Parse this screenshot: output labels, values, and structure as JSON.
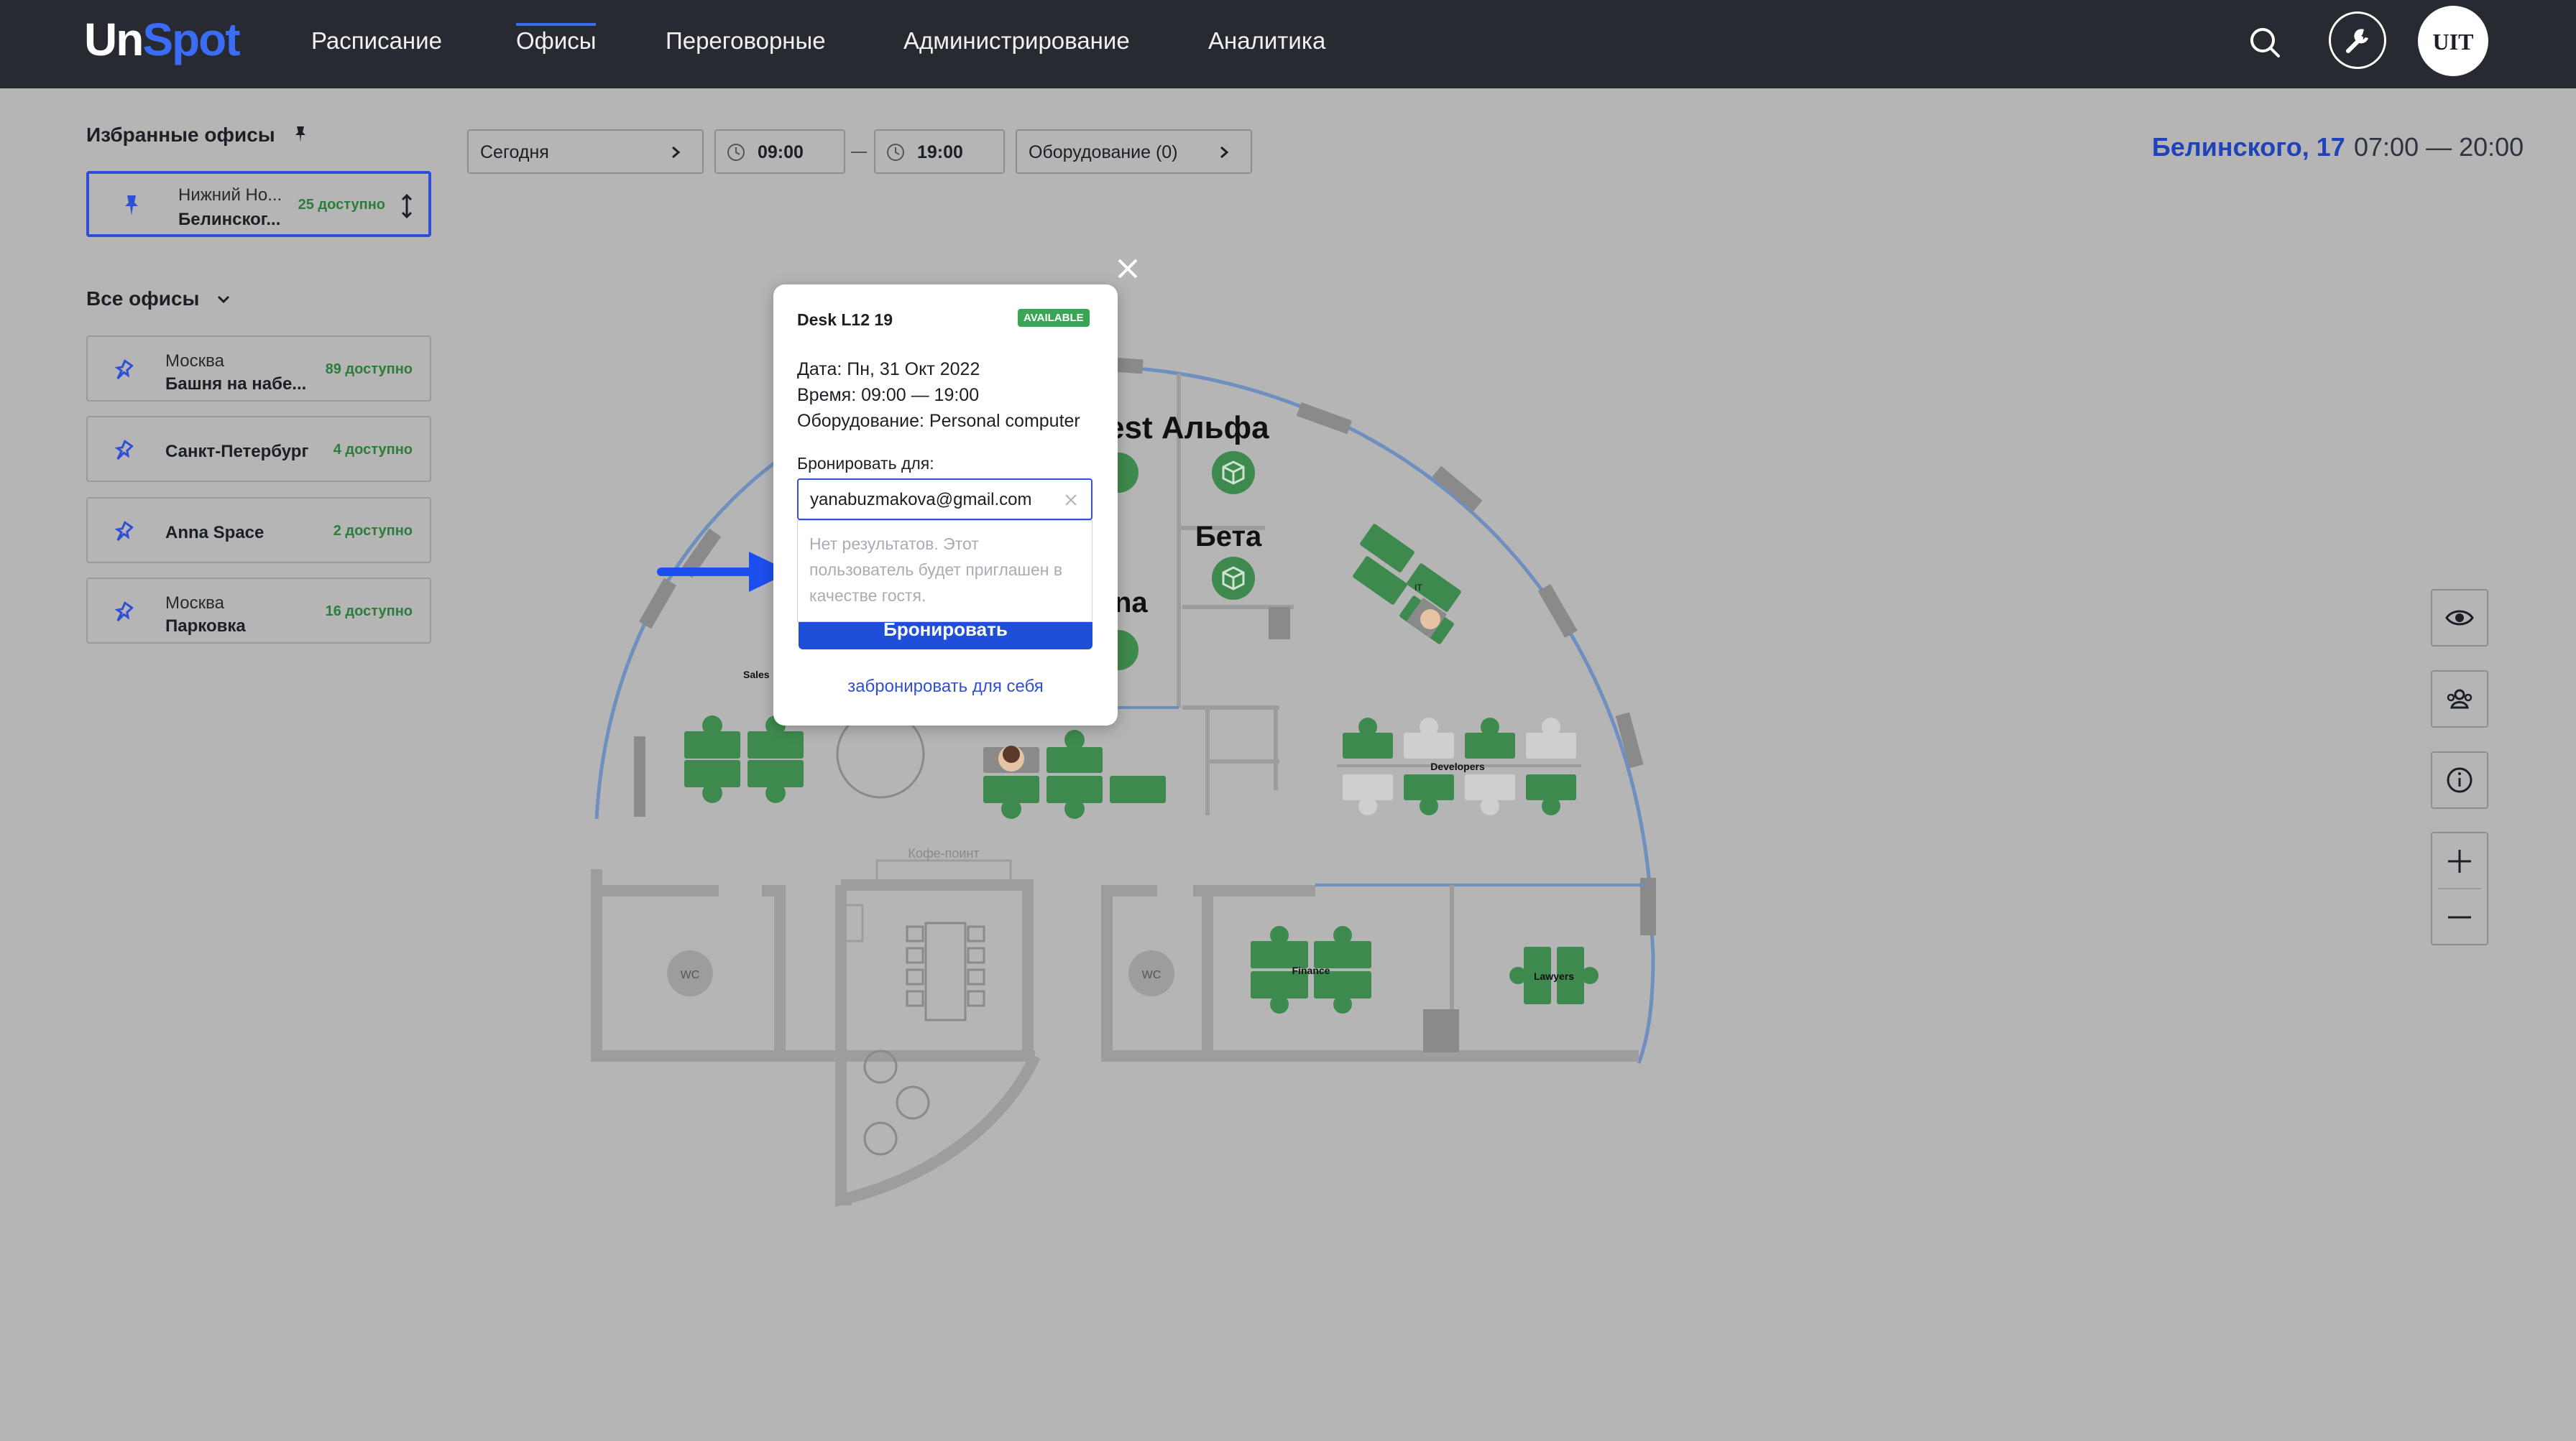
{
  "app": {
    "logo_un": "Un",
    "logo_spot": "Spot"
  },
  "nav": [
    {
      "label": "Расписание"
    },
    {
      "label": "Офисы"
    },
    {
      "label": "Переговорные"
    },
    {
      "label": "Администрирование"
    },
    {
      "label": "Аналитика"
    }
  ],
  "user": {
    "initials": "UIT"
  },
  "sidebar": {
    "favorites_title": "Избранные офисы",
    "favorite": {
      "city": "Нижний Но...",
      "name": "Белинског...",
      "available": "25 доступно"
    },
    "all_title": "Все офисы",
    "offices": [
      {
        "city": "Москва",
        "name": "Башня на набе...",
        "available": "89 доступно"
      },
      {
        "city": "",
        "name": "Санкт-Петербург",
        "available": "4 доступно"
      },
      {
        "city": "",
        "name": "Anna Space",
        "available": "2 доступно"
      },
      {
        "city": "Москва",
        "name": "Парковка",
        "available": "16 доступно"
      }
    ]
  },
  "filters": {
    "date": "Сегодня",
    "time_from": "09:00",
    "time_to": "19:00",
    "equipment": "Оборудование (0)"
  },
  "office_header": {
    "address": "Белинского, 17",
    "hours": "07:00 — 20:00"
  },
  "map": {
    "rooms": [
      "est Альфа",
      "Бета",
      "na"
    ],
    "zones": [
      "Sales",
      "Developers",
      "Finance",
      "Lawyers",
      "IT"
    ],
    "coffee": "Кофе-поинт",
    "wc": "WC"
  },
  "popup": {
    "title": "Desk L12 19",
    "status": "AVAILABLE",
    "date_line": "Дата: Пн, 31 Окт 2022",
    "time_line": "Время: 09:00 — 19:00",
    "equipment_line": "Оборудование: Personal computer",
    "book_for_label": "Бронировать для:",
    "input_value": "yanabuzmakova@gmail.com",
    "no_results": "Нет результатов. Этот пользователь будет приглашен в качестве гостя.",
    "submit_label": "Бронировать",
    "self_link": "забронировать для себя"
  },
  "colors": {
    "accent": "#3b6cf5",
    "desk_green": "#3e8a4e",
    "desk_grey": "#cfcfcf",
    "wall": "#9d9d9d",
    "available": "#3aa655"
  }
}
